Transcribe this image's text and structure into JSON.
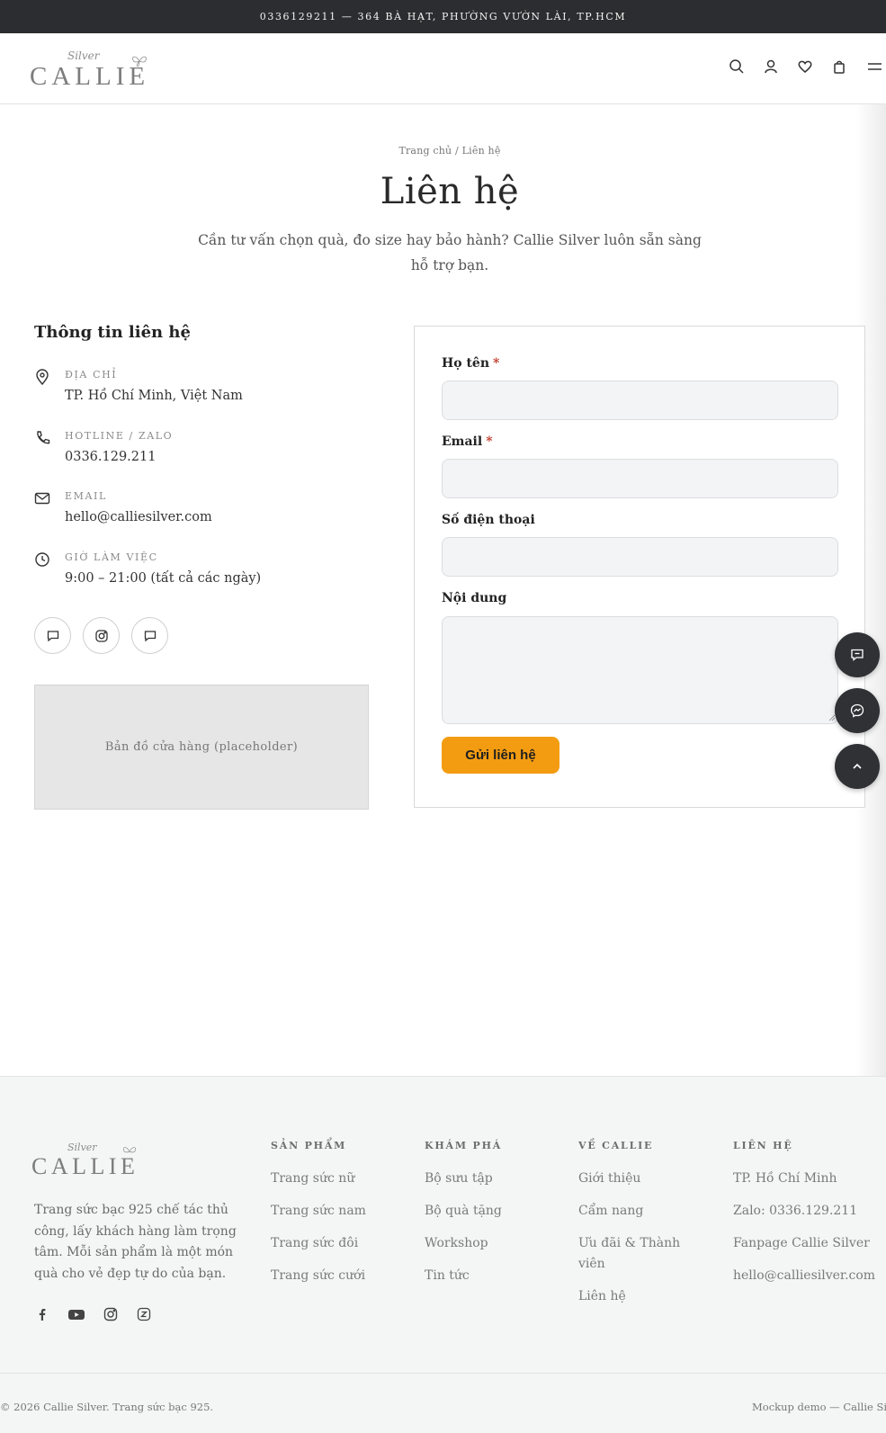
{
  "topbar": {
    "text": "0336129211 — 364 BÀ HẠT, PHƯỜNG VƯỜN LÀI, TP.HCM"
  },
  "brand": {
    "script": "Silver",
    "name": "CALLIE"
  },
  "breadcrumb": "Trang chủ / Liên hệ",
  "page": {
    "title": "Liên hệ",
    "intro": "Cần tư vấn chọn quà, đo size hay bảo hành? Callie Silver luôn sẵn sàng hỗ trợ bạn."
  },
  "contact_info": {
    "title": "Thông tin liên hệ",
    "items": [
      {
        "label": "ĐỊA CHỈ",
        "value": "TP. Hồ Chí Minh, Việt Nam",
        "icon": "map-pin-icon"
      },
      {
        "label": "HOTLINE / ZALO",
        "value": "0336.129.211",
        "icon": "phone-icon"
      },
      {
        "label": "EMAIL",
        "value": "hello@calliesilver.com",
        "icon": "mail-icon"
      },
      {
        "label": "GIỜ LÀM VIỆC",
        "value": "9:00 – 21:00 (tất cả các ngày)",
        "icon": "clock-icon"
      }
    ],
    "map_placeholder": "Bản đồ cửa hàng (placeholder)"
  },
  "form": {
    "name_label": "Họ tên",
    "email_label": "Email",
    "phone_label": "Số điện thoại",
    "message_label": "Nội dung",
    "required_mark": "*",
    "submit_label": "Gửi liên hệ",
    "submit_color": "#f39c12"
  },
  "footer": {
    "description": "Trang sức bạc 925 chế tác thủ công, lấy khách hàng làm trọng tâm. Mỗi sản phẩm là một món quà cho vẻ đẹp tự do của bạn.",
    "columns": [
      {
        "title": "SẢN PHẨM",
        "links": [
          "Trang sức nữ",
          "Trang sức nam",
          "Trang sức đôi",
          "Trang sức cưới"
        ]
      },
      {
        "title": "KHÁM PHÁ",
        "links": [
          "Bộ sưu tập",
          "Bộ quà tặng",
          "Workshop",
          "Tin tức"
        ]
      },
      {
        "title": "VỀ CALLIE",
        "links": [
          "Giới thiệu",
          "Cẩm nang",
          "Ưu đãi & Thành viên",
          "Liên hệ"
        ]
      },
      {
        "title": "LIÊN HỆ",
        "links": [
          "TP. Hồ Chí Minh",
          "Zalo: 0336.129.211",
          "Fanpage Callie Silver",
          "hello@calliesilver.com"
        ]
      }
    ],
    "copyright": "© 2026 Callie Silver. Trang sức bạc 925.",
    "right_note": "Mockup demo — Callie Silv"
  }
}
